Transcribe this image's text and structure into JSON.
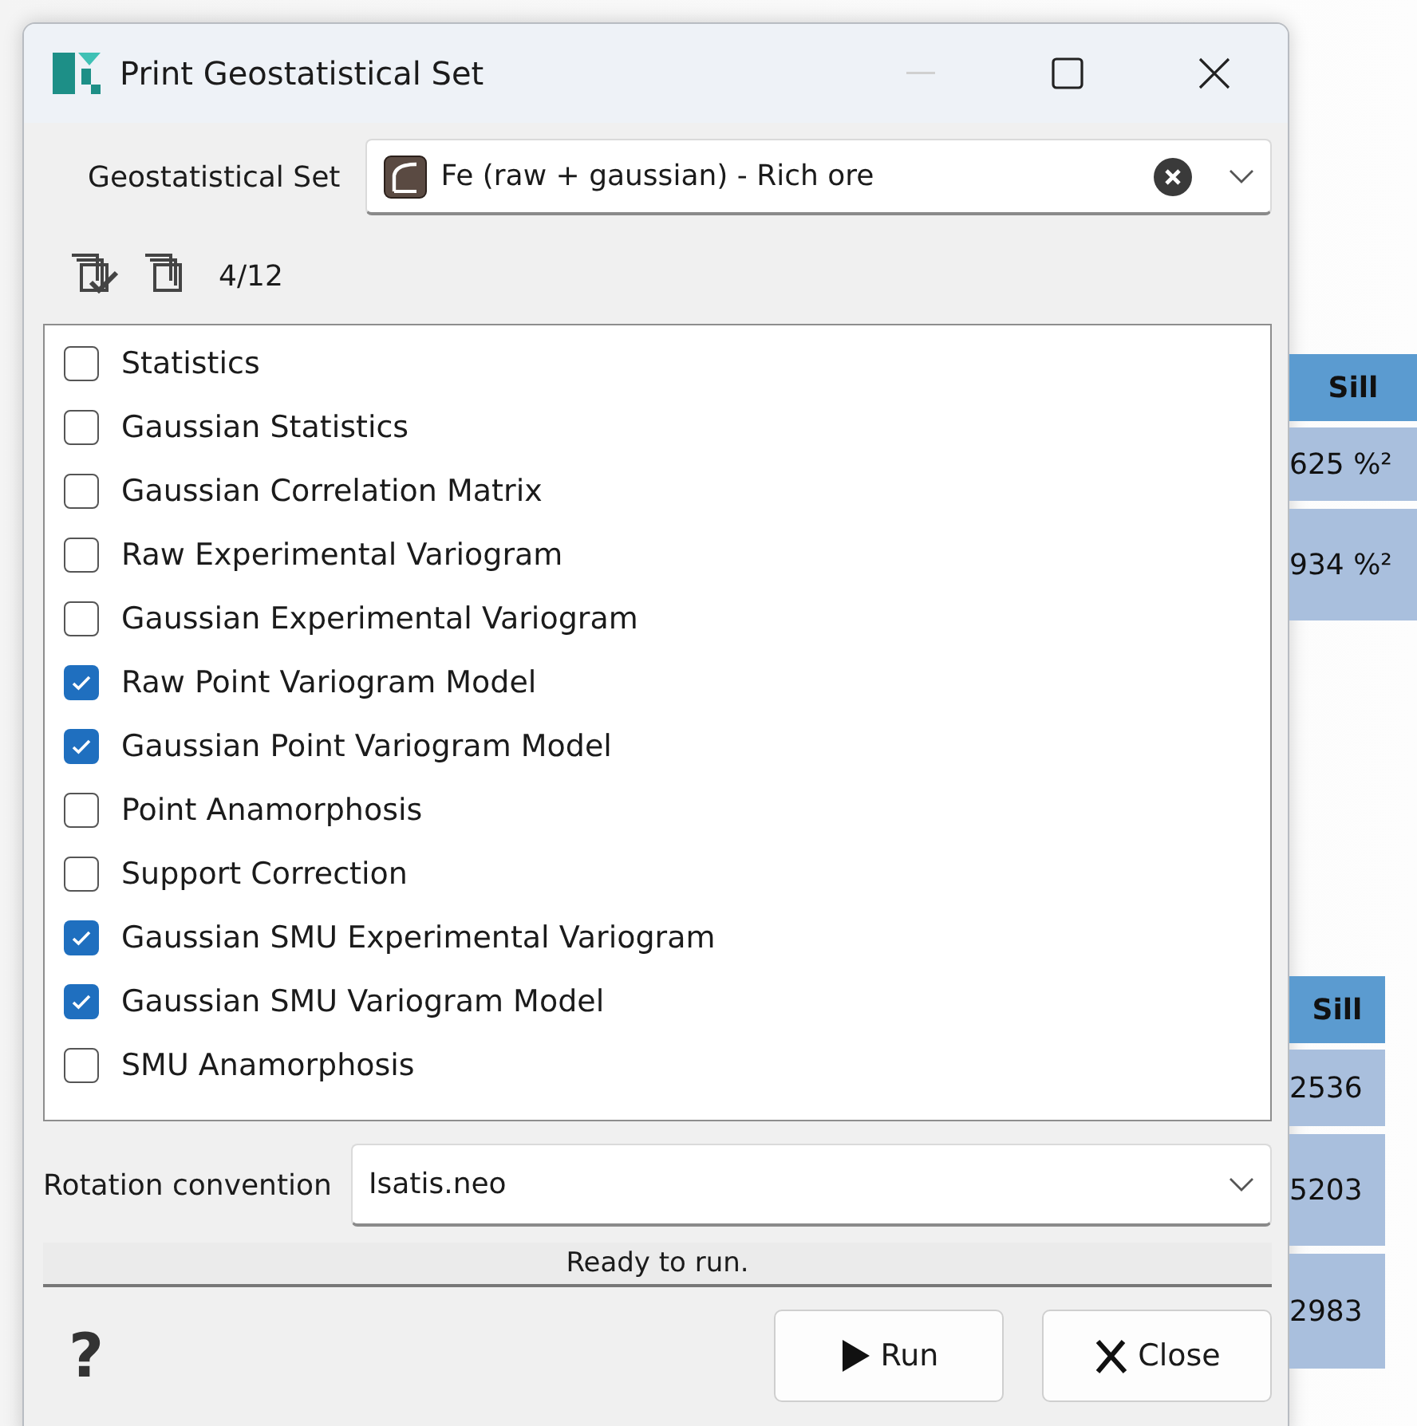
{
  "window": {
    "title": "Print Geostatistical Set"
  },
  "geostatistical_set": {
    "label": "Geostatistical Set",
    "value": "Fe (raw + gaussian) - Rich ore"
  },
  "toolbar": {
    "count": "4/12"
  },
  "items": [
    {
      "label": "Statistics",
      "checked": false
    },
    {
      "label": "Gaussian Statistics",
      "checked": false
    },
    {
      "label": "Gaussian Correlation Matrix",
      "checked": false
    },
    {
      "label": "Raw Experimental Variogram",
      "checked": false
    },
    {
      "label": "Gaussian Experimental Variogram",
      "checked": false
    },
    {
      "label": "Raw Point Variogram Model",
      "checked": true
    },
    {
      "label": "Gaussian Point Variogram Model",
      "checked": true
    },
    {
      "label": "Point Anamorphosis",
      "checked": false
    },
    {
      "label": "Support Correction",
      "checked": false
    },
    {
      "label": "Gaussian SMU Experimental Variogram",
      "checked": true
    },
    {
      "label": "Gaussian SMU Variogram Model",
      "checked": true
    },
    {
      "label": "SMU Anamorphosis",
      "checked": false
    }
  ],
  "rotation": {
    "label": "Rotation convention",
    "value": "Isatis.neo"
  },
  "status_bar": "Ready to run.",
  "help": "?",
  "buttons": [
    "Run",
    "Close"
  ],
  "background_tables": [
    {
      "header": "Sill",
      "cells": [
        "625 %²",
        "934 %²"
      ]
    },
    {
      "header": "Sill",
      "cells": [
        "2536",
        "5203",
        "2983"
      ]
    }
  ]
}
